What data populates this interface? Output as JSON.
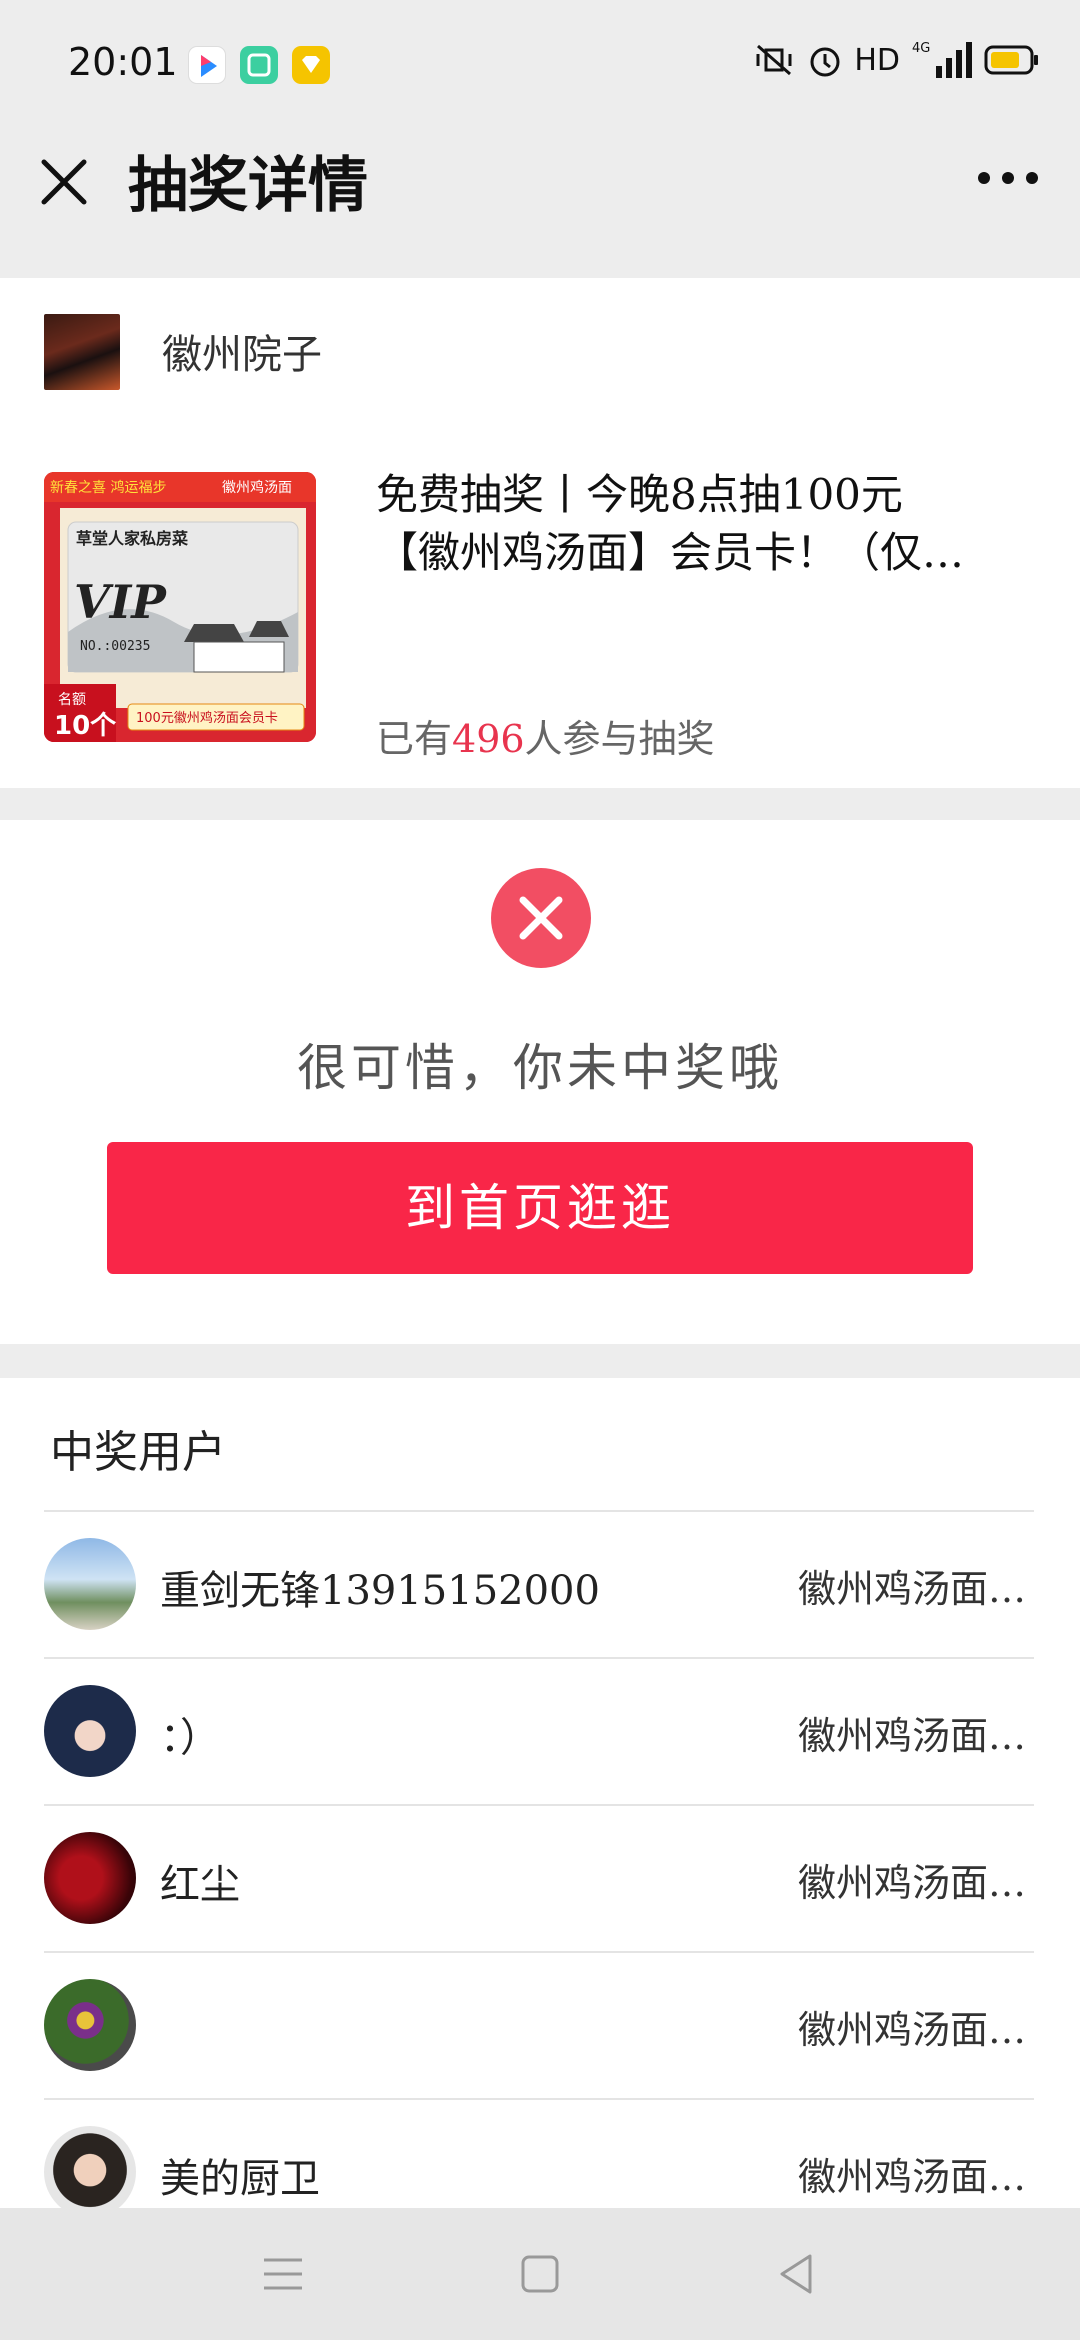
{
  "status_bar": {
    "time": "20:01",
    "network": "HD",
    "signal": "4G"
  },
  "nav": {
    "title": "抽奖详情"
  },
  "shop": {
    "name": "徽州院子"
  },
  "product": {
    "title_line1": "免费抽奖丨今晚8点抽100元",
    "title_line2": "【徽州鸡汤面】会员卡！（仅…",
    "participants_prefix": "已有",
    "participants_count": "496",
    "participants_suffix": "人参与抽奖",
    "thumb": {
      "top_left": "新春之喜 鸿运福步",
      "top_right": "徽州鸡汤面",
      "card_brand": "草堂人家私房菜",
      "vip": "VIP",
      "card_no": "NO.:00235",
      "quota_label": "名额",
      "quota_value": "10个",
      "bottom_caption": "100元徽州鸡汤面会员卡"
    }
  },
  "result": {
    "message": "很可惜，你未中奖哦",
    "button_label": "到首页逛逛"
  },
  "winners": {
    "title": "中奖用户",
    "items": [
      {
        "name": "重剑无锋13915152000",
        "prize": "徽州鸡汤面…"
      },
      {
        "name": "：）",
        "prize": "徽州鸡汤面…"
      },
      {
        "name": "红尘",
        "prize": "徽州鸡汤面…"
      },
      {
        "name": "",
        "prize": "徽州鸡汤面…"
      },
      {
        "name": "美的厨卫",
        "prize": "徽州鸡汤面…"
      }
    ]
  },
  "colors": {
    "accent": "#f92648",
    "count_red": "#e8344e",
    "fail_icon": "#f24e63"
  }
}
